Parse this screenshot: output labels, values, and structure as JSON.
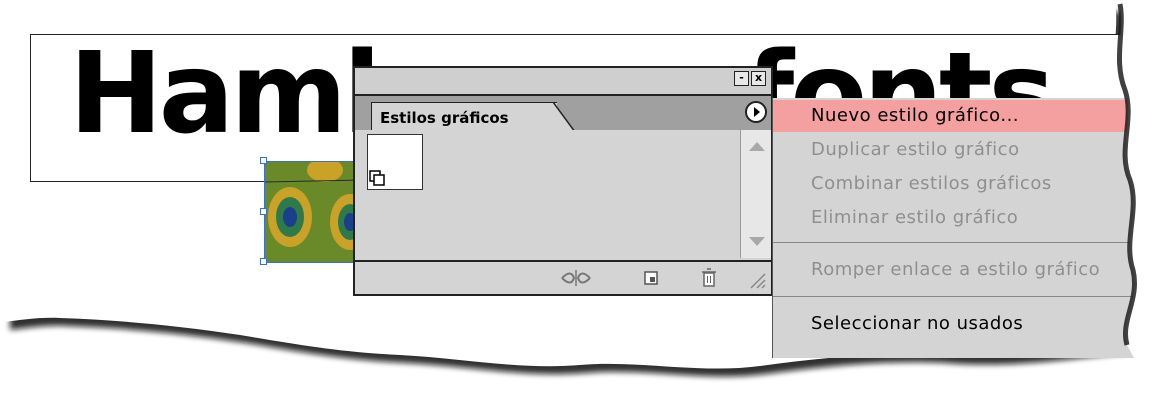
{
  "document": {
    "headline": "Hamburgerfonts"
  },
  "panel": {
    "tab_label": "Estilos gráficos",
    "minimize_glyph": "-",
    "close_glyph": "x"
  },
  "menu": {
    "items": [
      {
        "label": "Nuevo estilo gráfico...",
        "enabled": true,
        "highlighted": true
      },
      {
        "label": "Duplicar estilo gráfico",
        "enabled": false
      },
      {
        "label": "Combinar estilos gráficos",
        "enabled": false
      },
      {
        "label": "Eliminar estilo gráfico",
        "enabled": false
      },
      {
        "label": "Romper enlace a estilo gráfico",
        "enabled": false
      },
      {
        "label": "Seleccionar no usados",
        "enabled": true
      }
    ]
  },
  "colors": {
    "menu_highlight": "#f5a0a0",
    "selection_blue": "#3a6fd8",
    "panel_gray": "#d4d4d4"
  }
}
